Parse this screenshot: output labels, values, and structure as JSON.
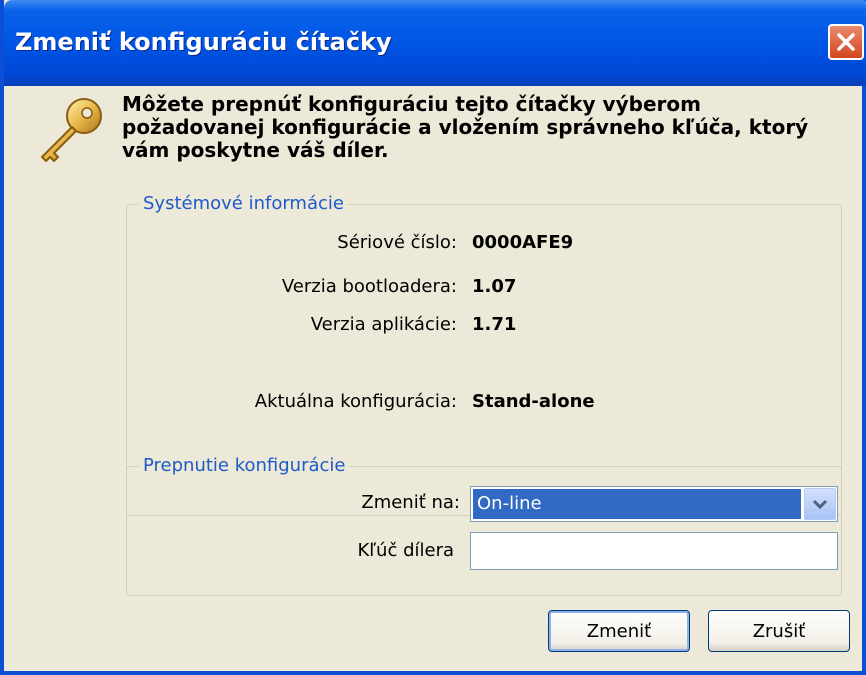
{
  "window": {
    "title": "Zmeniť konfiguráciu čítačky",
    "close_icon": "close-icon"
  },
  "intro": {
    "icon": "key-icon",
    "text": "Môžete prepnúť konfiguráciu tejto čítačky výberom požadovanej konfigurácie a vložením správneho kľúča, ktorý vám poskytne váš díler."
  },
  "system_info": {
    "label": "Systémové informácie",
    "serial_label": "Sériové číslo:",
    "serial_value": "0000AFE9",
    "bootloader_label": "Verzia bootloadera:",
    "bootloader_value": "1.07",
    "app_label": "Verzia aplikácie:",
    "app_value": "1.71",
    "config_label": "Aktuálna konfigurácia:",
    "config_value": "Stand-alone"
  },
  "switch_config": {
    "label": "Prepnutie konfigurácie",
    "change_to_label": "Zmeniť na:",
    "change_to_value": "On-line",
    "dealer_key_label": "Kľúč dílera",
    "dealer_key_value": ""
  },
  "buttons": {
    "change": "Zmeniť",
    "cancel": "Zrušiť"
  },
  "colors": {
    "titlebar": "#0055e5",
    "group_label": "#1e5ac8",
    "selection": "#316ac5",
    "dialog_bg": "#ece9d8"
  }
}
